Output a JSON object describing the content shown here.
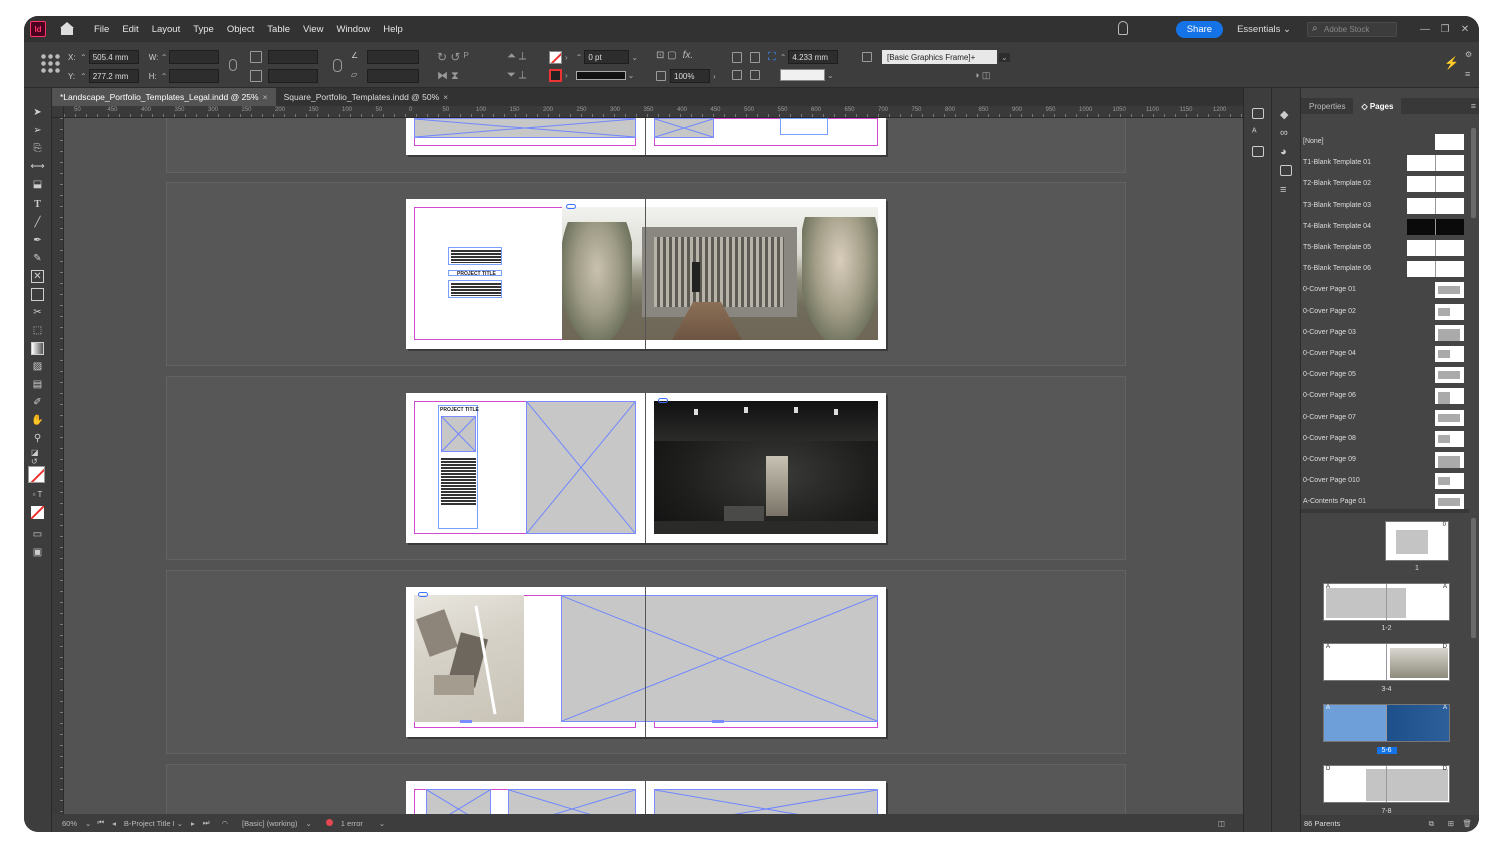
{
  "app": {
    "logo": "Id"
  },
  "menu": [
    "File",
    "Edit",
    "Layout",
    "Type",
    "Object",
    "Table",
    "View",
    "Window",
    "Help"
  ],
  "header": {
    "share_label": "Share",
    "workspace": "Essentials",
    "stock_placeholder": "Adobe Stock"
  },
  "control": {
    "x_label": "X:",
    "x_value": "505.4 mm",
    "y_label": "Y:",
    "y_value": "277.2 mm",
    "w_label": "W:",
    "h_label": "H:",
    "stroke_weight": "0 pt",
    "opacity": "100%",
    "offset": "4.233 mm",
    "frame_style": "[Basic Graphics Frame]+"
  },
  "tabs": [
    {
      "label": "*Landscape_Portfolio_Templates_Legal.indd @ 25%",
      "close": "×"
    },
    {
      "label": "Square_Portfolio_Templates.indd @ 50%",
      "close": "×"
    }
  ],
  "ruler_ticks": [
    "50",
    "450",
    "400",
    "350",
    "300",
    "250",
    "200",
    "150",
    "100",
    "50",
    "0",
    "50",
    "100",
    "150",
    "200",
    "250",
    "300",
    "350",
    "400",
    "450",
    "500",
    "550",
    "600",
    "650",
    "700",
    "750",
    "800",
    "850",
    "900",
    "950",
    "1000",
    "1050",
    "1100",
    "1150",
    "1200"
  ],
  "document": {
    "project_title_1": "PROJECT TITLE",
    "project_title_2": "PROJECT TITLE"
  },
  "statusbar": {
    "zoom": "60%",
    "page": "B-Project Title I",
    "preflight_profile": "[Basic] (working)",
    "errors": "1 error"
  },
  "panel": {
    "tabs": [
      "Properties",
      "Pages"
    ],
    "masters": [
      {
        "name": "[None]",
        "kind": "single"
      },
      {
        "name": "T1-Blank Template 01",
        "kind": "double"
      },
      {
        "name": "T2-Blank Template 02",
        "kind": "double"
      },
      {
        "name": "T3-Blank Template 03",
        "kind": "double"
      },
      {
        "name": "T4-Blank Template 04",
        "kind": "black"
      },
      {
        "name": "T5-Blank Template 05",
        "kind": "double"
      },
      {
        "name": "T6-Blank Template 06",
        "kind": "double"
      },
      {
        "name": "0-Cover Page 01",
        "kind": "single"
      },
      {
        "name": "0-Cover Page 02",
        "kind": "single"
      },
      {
        "name": "0-Cover Page 03",
        "kind": "single"
      },
      {
        "name": "0-Cover Page 04",
        "kind": "single"
      },
      {
        "name": "0-Cover Page 05",
        "kind": "single"
      },
      {
        "name": "0-Cover Page 06",
        "kind": "single"
      },
      {
        "name": "0-Cover Page 07",
        "kind": "single"
      },
      {
        "name": "0-Cover Page 08",
        "kind": "single"
      },
      {
        "name": "0-Cover Page 09",
        "kind": "single"
      },
      {
        "name": "0-Cover Page 010",
        "kind": "single"
      },
      {
        "name": "A-Contents Page 01",
        "kind": "single"
      }
    ],
    "pages": [
      {
        "label": "1",
        "masters": [
          "0"
        ]
      },
      {
        "label": "1-2",
        "masters": [
          "A",
          "A"
        ]
      },
      {
        "label": "3-4",
        "masters": [
          "A",
          "D"
        ]
      },
      {
        "label": "5-6",
        "masters": [
          "A",
          "A"
        ],
        "selected": true
      },
      {
        "label": "7-8",
        "masters": [
          "D",
          "D"
        ]
      }
    ],
    "footer": "86 Parents"
  }
}
